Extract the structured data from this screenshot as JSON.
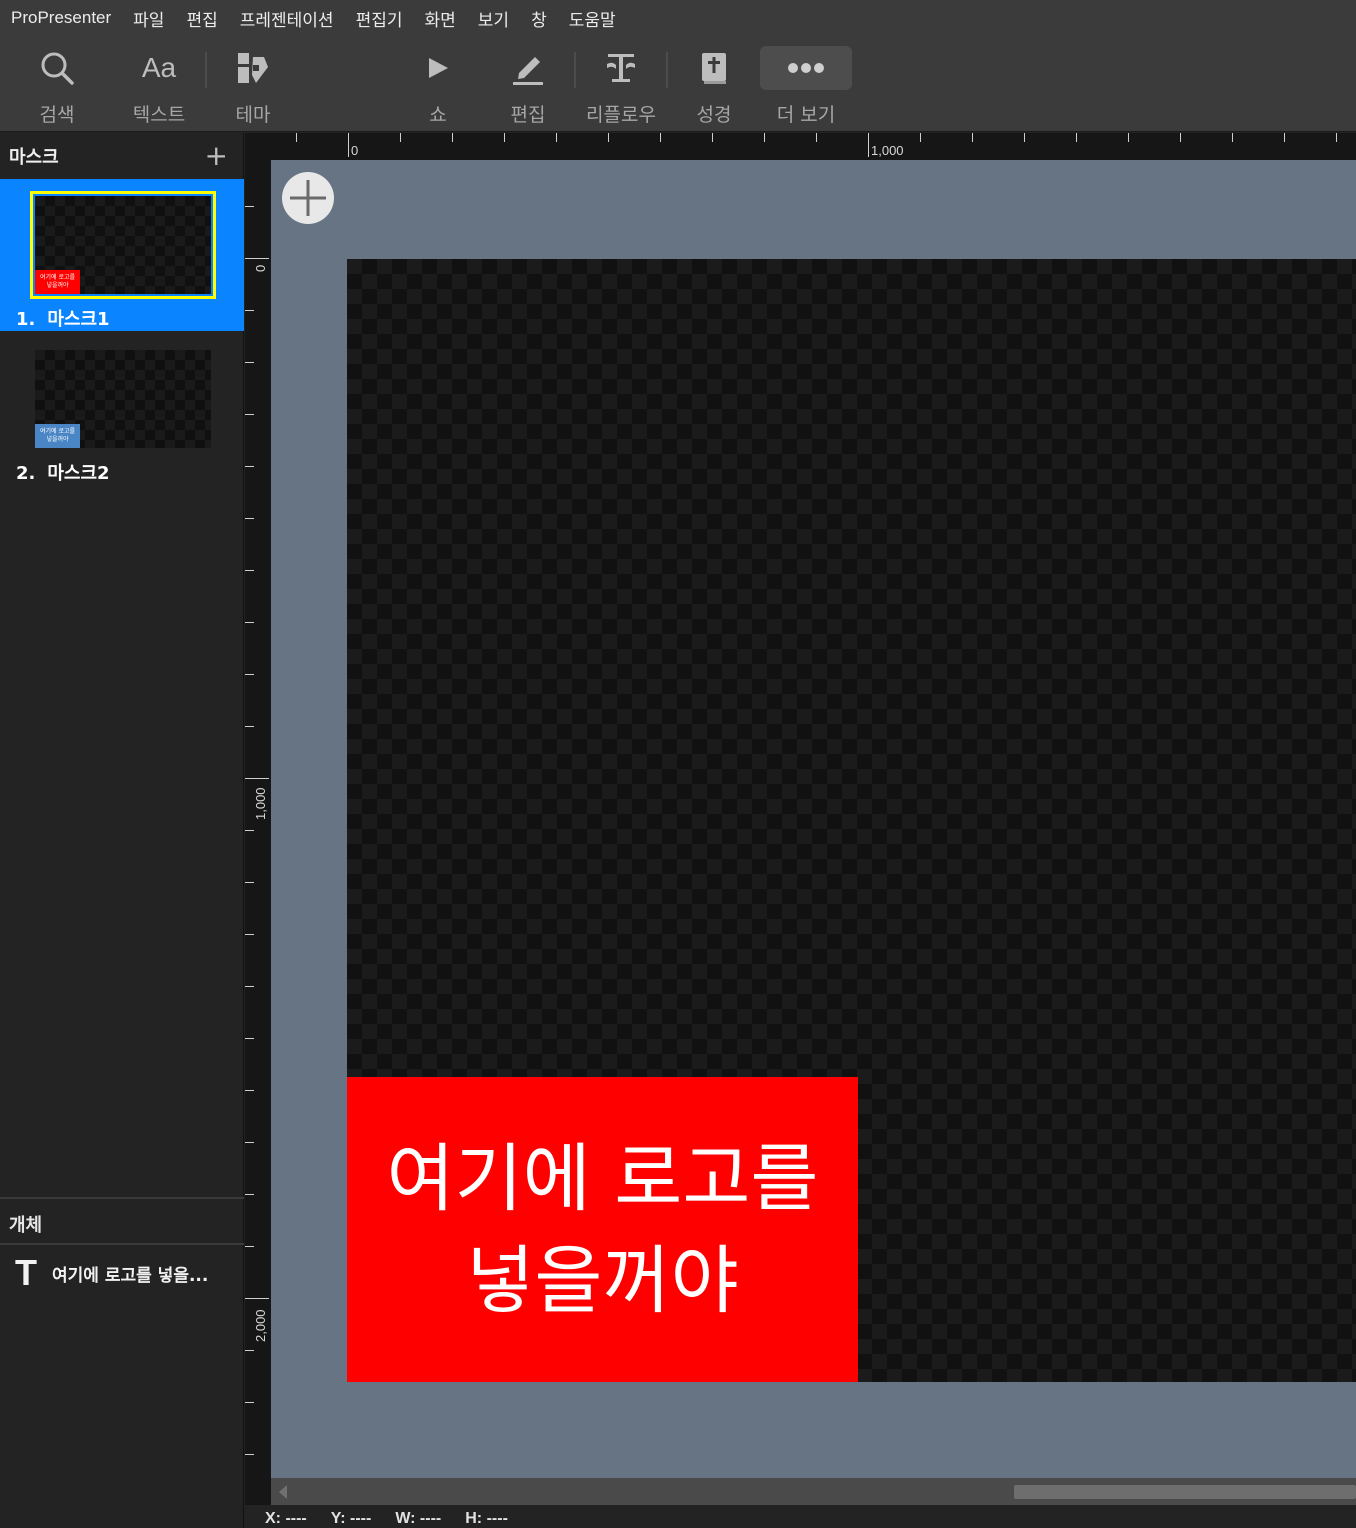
{
  "menu": [
    "ProPresenter",
    "파일",
    "편집",
    "프레젠테이션",
    "편집기",
    "화면",
    "보기",
    "창",
    "도움말"
  ],
  "toolbar": {
    "search": "검색",
    "text": "텍스트",
    "theme": "테마",
    "show": "쇼",
    "edit": "편집",
    "reflow": "리플로우",
    "bible": "성경",
    "more": "더 보기"
  },
  "masks_panel": {
    "title": "마스크",
    "items": [
      {
        "num": "1.",
        "name": "마스크1",
        "logo_text": "여기에 로고를 넣을꺼야",
        "logo_color": "#ff0000",
        "selected": true
      },
      {
        "num": "2.",
        "name": "마스크2",
        "logo_text": "여기에 로고를 넣을꺼야",
        "logo_color": "#4a86c5",
        "selected": false
      }
    ]
  },
  "objects_panel": {
    "title": "개체",
    "items": [
      {
        "type_icon": "T",
        "name": "여기에 로고를 넣을..."
      }
    ]
  },
  "rulers": {
    "top_labels": [
      "0",
      "1,000"
    ],
    "left_labels": [
      "0",
      "1,000",
      "2,000"
    ]
  },
  "canvas": {
    "logo_text": "여기에 로고를 넣을꺼야",
    "logo_color": "#ff0000",
    "background_color": "#677484"
  },
  "status": {
    "x": "X: ----",
    "y": "Y: ----",
    "w": "W: ----",
    "h": "H: ----"
  }
}
